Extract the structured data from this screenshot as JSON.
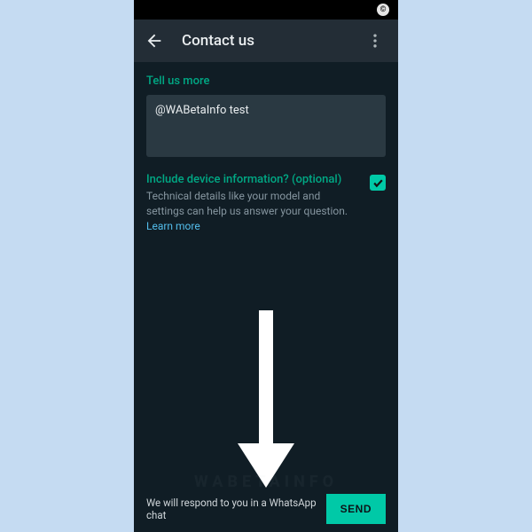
{
  "statusbar": {
    "badge": "©"
  },
  "appbar": {
    "title": "Contact us"
  },
  "form": {
    "section_label": "Tell us more",
    "input_value": "@WABetaInfo test",
    "device_heading": "Include device information? (optional)",
    "device_desc": "Technical details like your model and settings can help us answer your question. ",
    "learn_more": "Learn more"
  },
  "footer": {
    "text": "We will respond to you in a WhatsApp chat",
    "send": "SEND"
  },
  "watermark": "WABETAINFO"
}
